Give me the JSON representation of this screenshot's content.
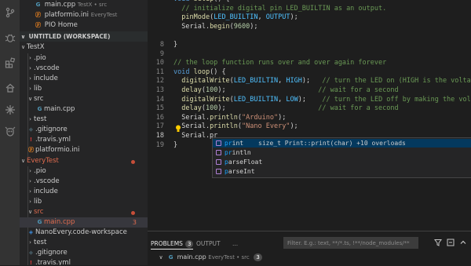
{
  "sidebar": {
    "open_editors": [
      {
        "name": "main.cpp",
        "detail": "TestX • src"
      },
      {
        "name": "platformio.ini",
        "detail": "EveryTest"
      },
      {
        "name": "PIO Home",
        "detail": ""
      }
    ],
    "workspace_title": "UNTITLED (WORKSPACE)",
    "tree": [
      {
        "label": "TestX"
      },
      {
        "label": ".pio"
      },
      {
        "label": ".vscode"
      },
      {
        "label": "include"
      },
      {
        "label": "lib"
      },
      {
        "label": "src"
      },
      {
        "label": "main.cpp"
      },
      {
        "label": "test"
      },
      {
        "label": ".gitignore"
      },
      {
        "label": ".travis.yml"
      },
      {
        "label": "platformio.ini"
      },
      {
        "label": "EveryTest"
      },
      {
        "label": ".pio"
      },
      {
        "label": ".vscode"
      },
      {
        "label": "include"
      },
      {
        "label": "lib"
      },
      {
        "label": "src"
      },
      {
        "label": "main.cpp",
        "badge": "3"
      },
      {
        "label": "NanoEvery.code-workspace"
      },
      {
        "label": "test"
      },
      {
        "label": ".gitignore"
      },
      {
        "label": ".travis.yml"
      }
    ]
  },
  "editor": {
    "line_numbers": [
      "",
      "",
      "",
      "",
      "",
      "",
      "",
      "8",
      "9",
      "10",
      "11",
      "12",
      "13",
      "14",
      "15",
      "16",
      "17",
      "18",
      "19"
    ],
    "lines": [
      "void setup() {",
      "  // initialize digital pin LED_BUILTIN as an output.",
      "  pinMode(LED_BUILTIN, OUTPUT);",
      "  Serial.begin(9600);",
      "",
      "}",
      "",
      "// the loop function runs over and over again forever",
      "void loop() {",
      "  digitalWrite(LED_BUILTIN, HIGH);   // turn the LED on (HIGH is the voltage level)",
      "  delay(100);                       // wait for a second",
      "  digitalWrite(LED_BUILTIN, LOW);    // turn the LED off by making the voltage LOW",
      "  delay(100);                       // wait for a second",
      "  Serial.println(\"Arduino\");",
      "  Serial.println(\"Nano Every\");",
      "  Serial.pr",
      "}"
    ],
    "suggestions": [
      {
        "match": "pr",
        "rest": "int",
        "detail": "size_t Print::print(char) +10 overloads"
      },
      {
        "match": "pr",
        "rest": "intln",
        "detail": ""
      },
      {
        "match": "p",
        "rest": "arseFloat",
        "detail": "",
        "mid": "r"
      },
      {
        "match": "p",
        "rest": "arseInt",
        "detail": "",
        "mid": "r"
      }
    ]
  },
  "panel": {
    "tabs": [
      {
        "label": "PROBLEMS",
        "badge": "3"
      },
      {
        "label": "OUTPUT"
      }
    ],
    "more": "...",
    "filter_placeholder": "Filter. E.g.: text, **/*.ts, !**/node_modules/**",
    "problem_file": "main.cpp",
    "problem_detail": "EveryTest • src",
    "problem_count": "3"
  }
}
